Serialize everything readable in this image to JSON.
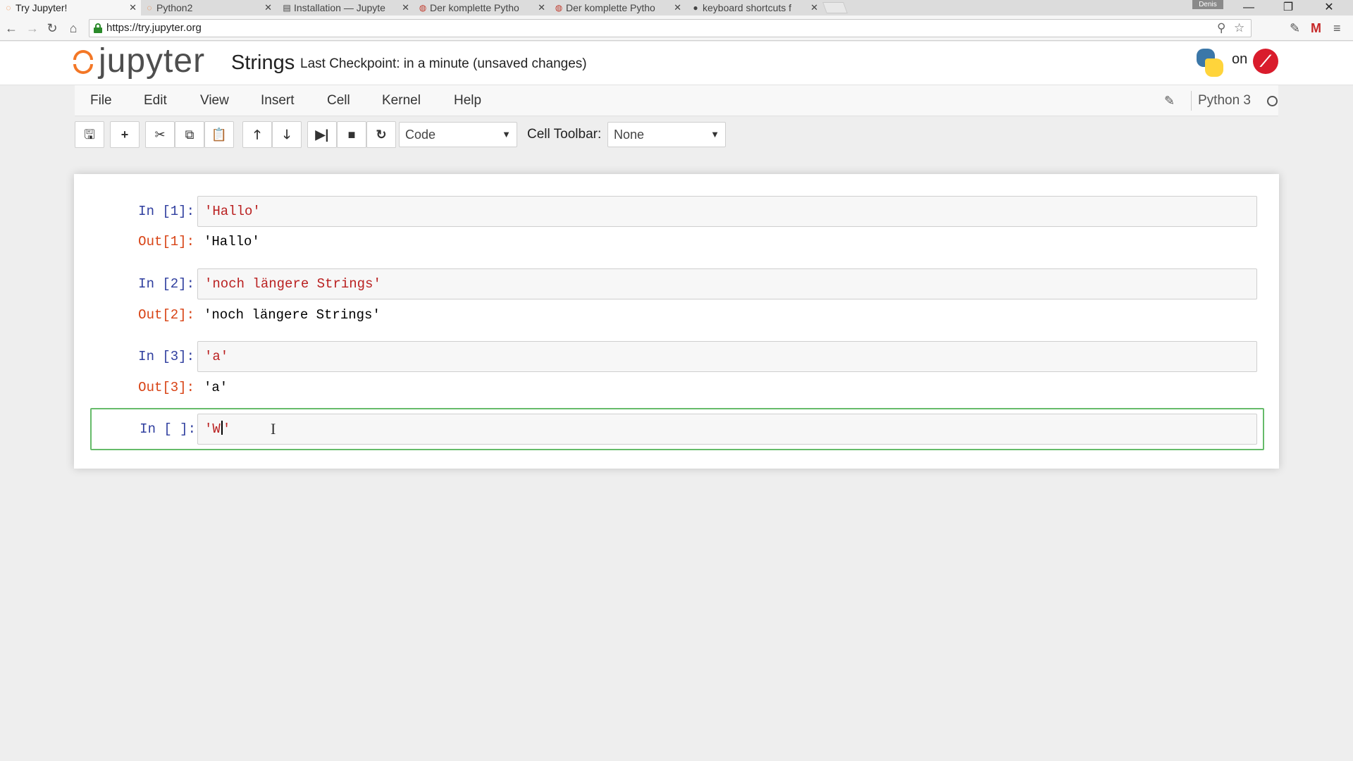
{
  "browser": {
    "tabs": [
      {
        "label": "Try Jupyter!",
        "icon": "jupyter-icon",
        "active": true
      },
      {
        "label": "Python2",
        "icon": "jupyter-icon",
        "active": false
      },
      {
        "label": "Installation — Jupyte",
        "icon": "document-icon",
        "active": false
      },
      {
        "label": "Der komplette Pytho",
        "icon": "udemy-icon",
        "active": false
      },
      {
        "label": "Der komplette Pytho",
        "icon": "udemy-icon",
        "active": false
      },
      {
        "label": "keyboard shortcuts f",
        "icon": "github-icon",
        "active": false
      }
    ],
    "profile_tag": "Denis",
    "url": "https://try.jupyter.org"
  },
  "notebook": {
    "logo_text": "jupyter",
    "name": "Strings",
    "checkpoint": "Last Checkpoint: in a minute (unsaved changes)",
    "on_text": "on",
    "menu": [
      "File",
      "Edit",
      "View",
      "Insert",
      "Cell",
      "Kernel",
      "Help"
    ],
    "kernel": "Python 3",
    "cell_type": "Code",
    "cell_toolbar_label": "Cell Toolbar:",
    "cell_toolbar_value": "None",
    "cells": [
      {
        "in_prompt": "In [1]:",
        "code": "'Hallo'",
        "out_prompt": "Out[1]:",
        "output": "'Hallo'"
      },
      {
        "in_prompt": "In [2]:",
        "code": "'noch längere Strings'",
        "out_prompt": "Out[2]:",
        "output": "'noch längere Strings'"
      },
      {
        "in_prompt": "In [3]:",
        "code": "'a'",
        "out_prompt": "Out[3]:",
        "output": "'a'"
      },
      {
        "in_prompt": "In [ ]:",
        "code_before_cursor": "'W",
        "code_after_cursor": "'"
      }
    ]
  },
  "colors": {
    "jupyter_orange": "#f37726",
    "in_prompt": "#303f9f",
    "out_prompt": "#d84315",
    "string_literal": "#ba2121",
    "selected_border": "#66bb6a"
  }
}
